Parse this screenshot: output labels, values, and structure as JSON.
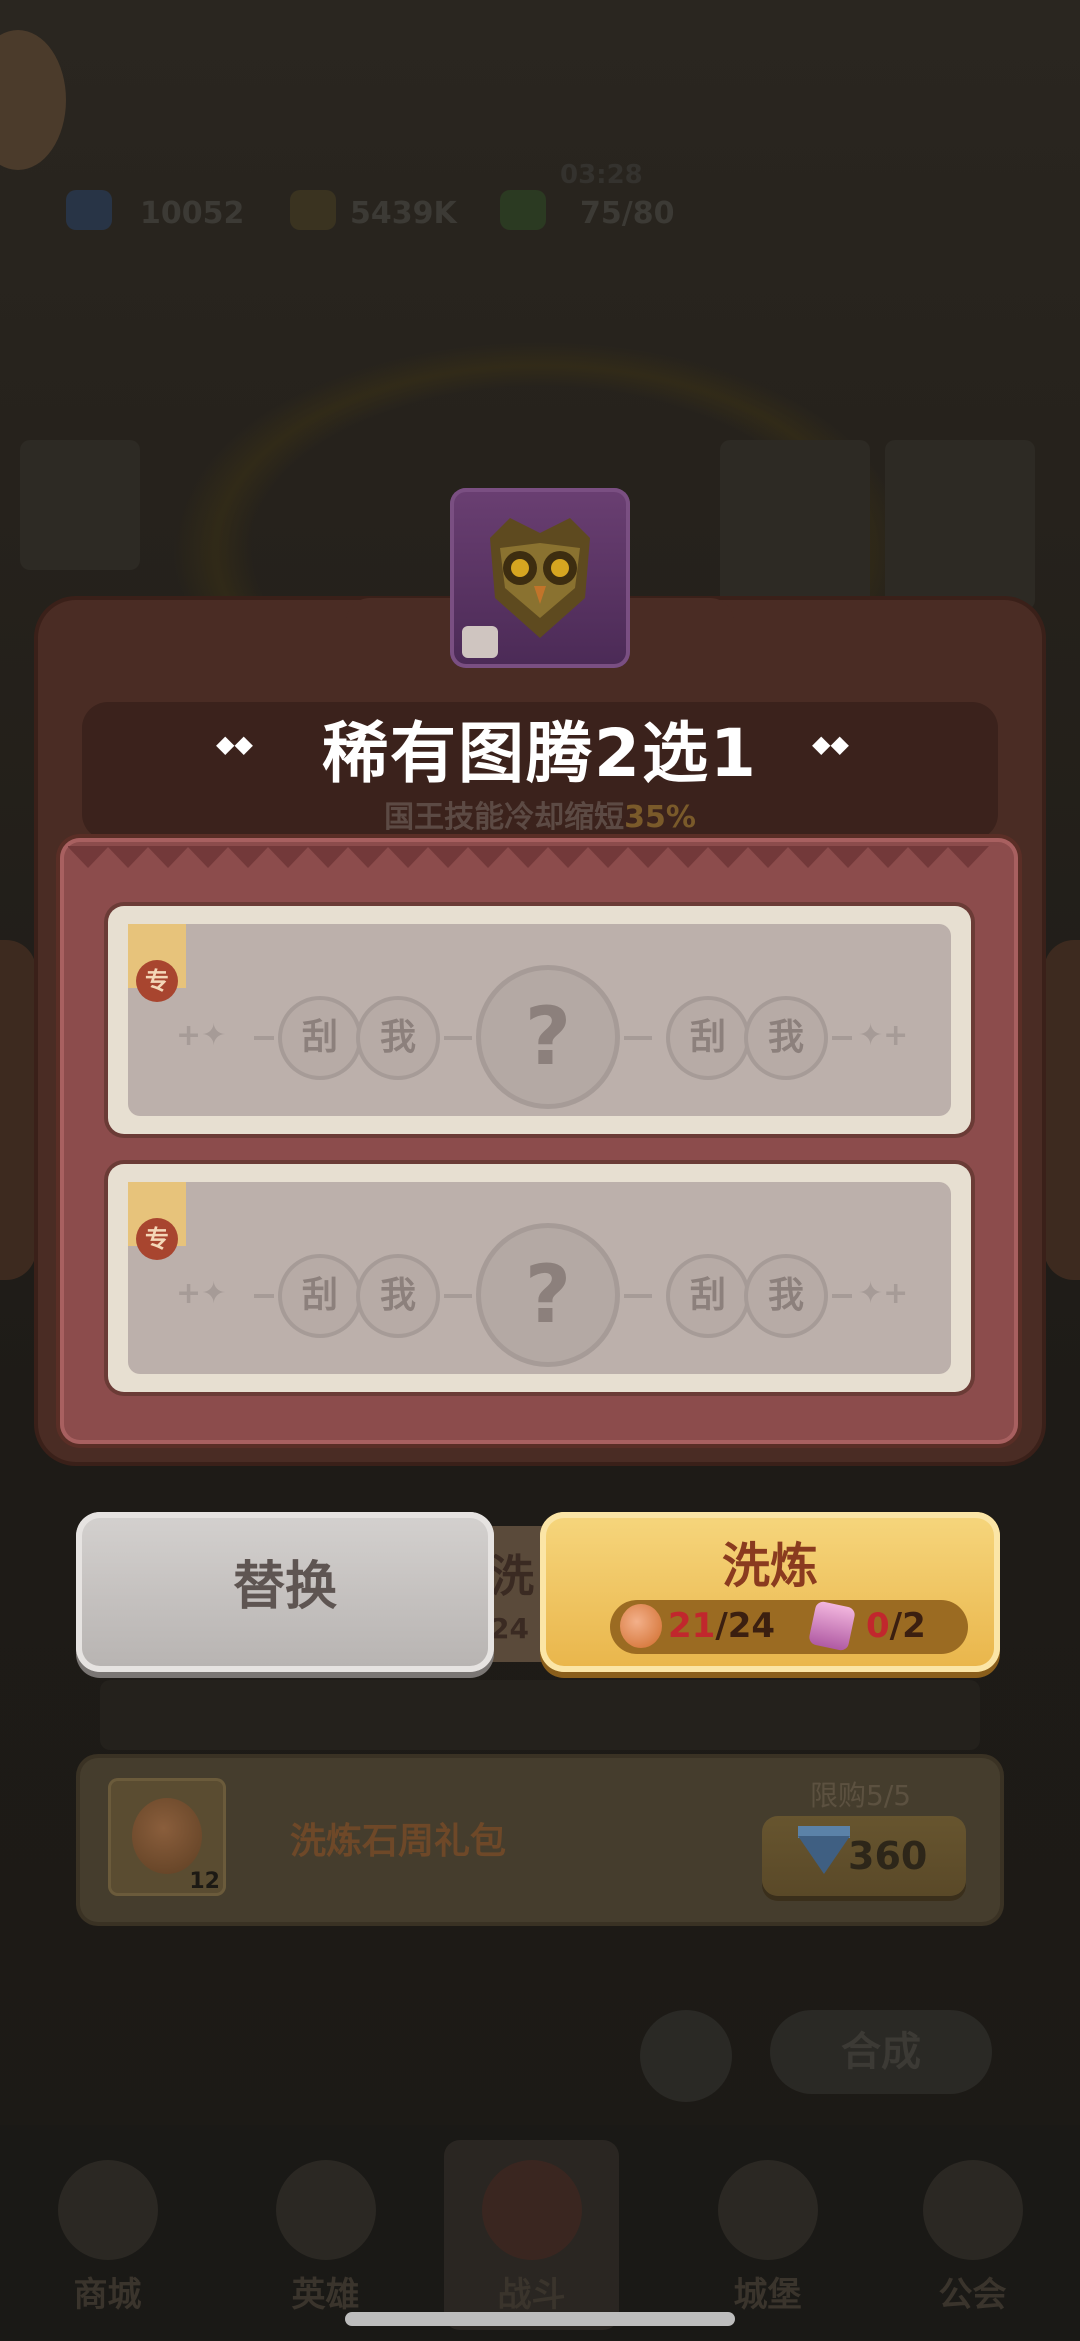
{
  "background": {
    "timer": "03:28",
    "resources": [
      {
        "name": "gem",
        "value": "10052"
      },
      {
        "name": "gold",
        "value": "5439K"
      },
      {
        "name": "energy",
        "value": "75/80"
      }
    ],
    "hidden_button": "洗",
    "hidden_count": "24",
    "synthesize_label": "合成",
    "tabs": [
      {
        "label": "商城"
      },
      {
        "label": "英雄"
      },
      {
        "label": "战斗"
      },
      {
        "label": "城堡"
      },
      {
        "label": "公会"
      }
    ]
  },
  "dialog": {
    "icon": "owl-mask-icon",
    "title": "稀有图腾2选1",
    "subtitle_prefix": "国王技能冷却缩短",
    "subtitle_percent": "35%",
    "cards": [
      {
        "badge": "专",
        "scratch_left": [
          "刮",
          "我"
        ],
        "mystery": "?",
        "scratch_right": [
          "刮",
          "我"
        ]
      },
      {
        "badge": "专",
        "scratch_left": [
          "刮",
          "我"
        ],
        "mystery": "?",
        "scratch_right": [
          "刮",
          "我"
        ]
      }
    ],
    "replace_button": "替换",
    "refine_button": "洗炼",
    "refine_cost": {
      "stone_have": "21",
      "stone_need": "/24",
      "crystal_have": "0",
      "crystal_need": "/2"
    }
  },
  "gift_pack": {
    "name": "洗炼石周礼包",
    "count": "12",
    "limit": "限购5/5",
    "price": "360"
  },
  "colors": {
    "dialog_bg": "#4a2c24",
    "card_frame": "#8c4c4c",
    "refine_button": "#f0c35f",
    "replace_button": "#c9c6c4",
    "accent_red": "#c1272d"
  }
}
